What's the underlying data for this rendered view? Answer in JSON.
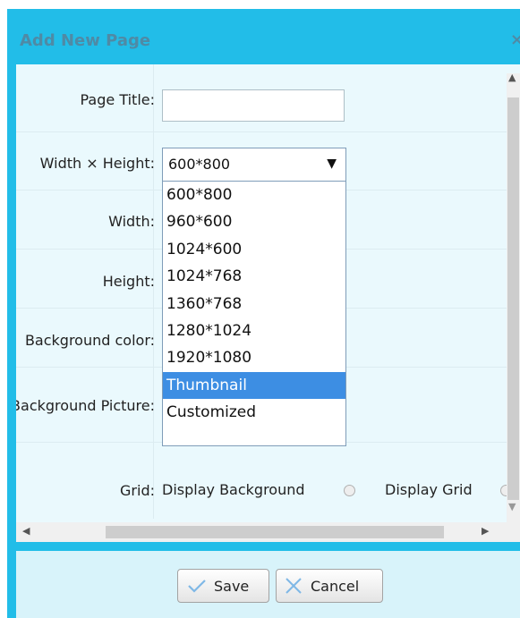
{
  "dialog": {
    "title": "Add New Page",
    "close_glyph": "×"
  },
  "form": {
    "page_title_label": "Page Title:",
    "page_title_value": "",
    "size_label": "Width × Height:",
    "size_selected": "600*800",
    "size_arrow": "▼",
    "size_options": [
      "600*800",
      "960*600",
      "1024*600",
      "1024*768",
      "1360*768",
      "1280*1024",
      "1920*1080",
      "Thumbnail",
      "Customized"
    ],
    "size_highlighted": "Thumbnail",
    "width_label": "Width:",
    "height_label": "Height:",
    "bg_color_label": "Background color:",
    "bg_picture_label": "Background Picture:",
    "grid_label": "Grid:",
    "display_background_label": "Display Background",
    "display_grid_label": "Display Grid"
  },
  "scrollbars": {
    "up": "▲",
    "down": "▼",
    "left": "◀",
    "right": "▶"
  },
  "footer": {
    "save_label": "Save",
    "cancel_label": "Cancel"
  },
  "colors": {
    "dialog_border": "#22bde8",
    "content_bg": "#eaf9fd",
    "title_text": "#4f8aa5",
    "selection": "#3d8ee3"
  }
}
